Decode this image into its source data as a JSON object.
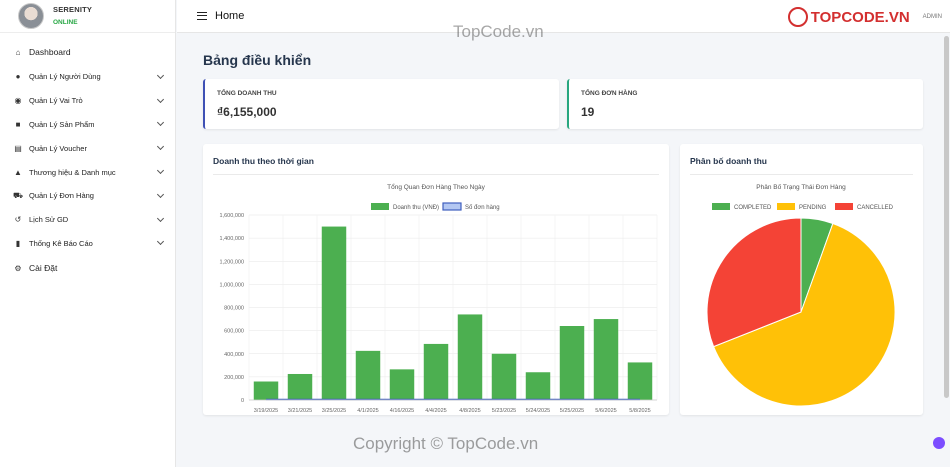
{
  "sidebar": {
    "brand": {
      "name": "SERENITY",
      "status": "ONLINE"
    },
    "items": [
      {
        "label": "Dashboard",
        "icon": "home-icon",
        "glyph": "⌂",
        "expandable": false
      },
      {
        "label": "Quản Lý Người Dùng",
        "icon": "user-icon",
        "glyph": "●",
        "expandable": true
      },
      {
        "label": "Quản Lý Vai Trò",
        "icon": "account-circle-icon",
        "glyph": "◉",
        "expandable": true
      },
      {
        "label": "Quản Lý Sản Phẩm",
        "icon": "shopping-bag-icon",
        "glyph": "■",
        "expandable": true
      },
      {
        "label": "Quản Lý Voucher",
        "icon": "voucher-icon",
        "glyph": "▤",
        "expandable": true
      },
      {
        "label": "Thương hiệu & Danh mục",
        "icon": "category-icon",
        "glyph": "▲",
        "expandable": true
      },
      {
        "label": "Quản Lý Đơn Hàng",
        "icon": "cart-icon",
        "glyph": "⛟",
        "expandable": true
      },
      {
        "label": "Lịch Sử GD",
        "icon": "history-icon",
        "glyph": "↺",
        "expandable": true
      },
      {
        "label": "Thống Kê Báo Cáo",
        "icon": "bar-chart-icon",
        "glyph": "▮",
        "expandable": true
      },
      {
        "label": "Cài Đặt",
        "icon": "gear-icon",
        "glyph": "⚙",
        "expandable": false
      }
    ]
  },
  "topbar": {
    "title": "Home",
    "admin": "ADMIN",
    "logo": "TOPCODE.VN"
  },
  "main": {
    "page_title": "Bảng điều khiển",
    "stats": [
      {
        "label": "TỔNG DOANH THU",
        "value": "₫6,155,000"
      },
      {
        "label": "TỔNG ĐƠN HÀNG",
        "value": "19"
      }
    ],
    "revenue_card_title": "Doanh thu theo thời gian",
    "distribution_card_title": "Phân bố doanh thu"
  },
  "watermark": "Copyright © TopCode.vn",
  "watermark_top": "TopCode.vn",
  "colors": {
    "green": "#4caf50",
    "blue": "#3f5fbf",
    "yellow": "#ffc107",
    "red": "#f44336"
  },
  "chart_data": [
    {
      "type": "bar",
      "title": "Tổng Quan Đơn Hàng Theo Ngày",
      "categories": [
        "3/19/2025",
        "3/21/2025",
        "3/25/2025",
        "4/1/2025",
        "4/16/2025",
        "4/4/2025",
        "4/8/2025",
        "5/23/2025",
        "5/24/2025",
        "5/25/2025",
        "5/6/2025",
        "5/8/2025"
      ],
      "series": [
        {
          "name": "Doanh thu (VNĐ)",
          "color": "#4caf50",
          "values": [
            160000,
            225000,
            1500000,
            425000,
            265000,
            485000,
            740000,
            400000,
            240000,
            640000,
            700000,
            325000
          ]
        },
        {
          "name": "Số đơn hàng",
          "color": "#3f5fbf",
          "values": [
            1,
            1,
            2,
            2,
            1,
            2,
            2,
            2,
            1,
            2,
            2,
            1
          ]
        }
      ],
      "ylim": [
        0,
        1600000
      ],
      "yticks": [
        "0",
        "200,000",
        "400,000",
        "600,000",
        "800,000",
        "1,000,000",
        "1,200,000",
        "1,400,000",
        "1,600,000"
      ],
      "legend": "top",
      "grid": true
    },
    {
      "type": "pie",
      "title": "Phân Bố Trạng Thái Đơn Hàng",
      "labels": [
        "COMPLETED",
        "PENDING",
        "CANCELLED"
      ],
      "values": [
        5.5,
        63.5,
        31
      ],
      "colors": [
        "#4caf50",
        "#ffc107",
        "#f44336"
      ],
      "legend": "top"
    }
  ]
}
